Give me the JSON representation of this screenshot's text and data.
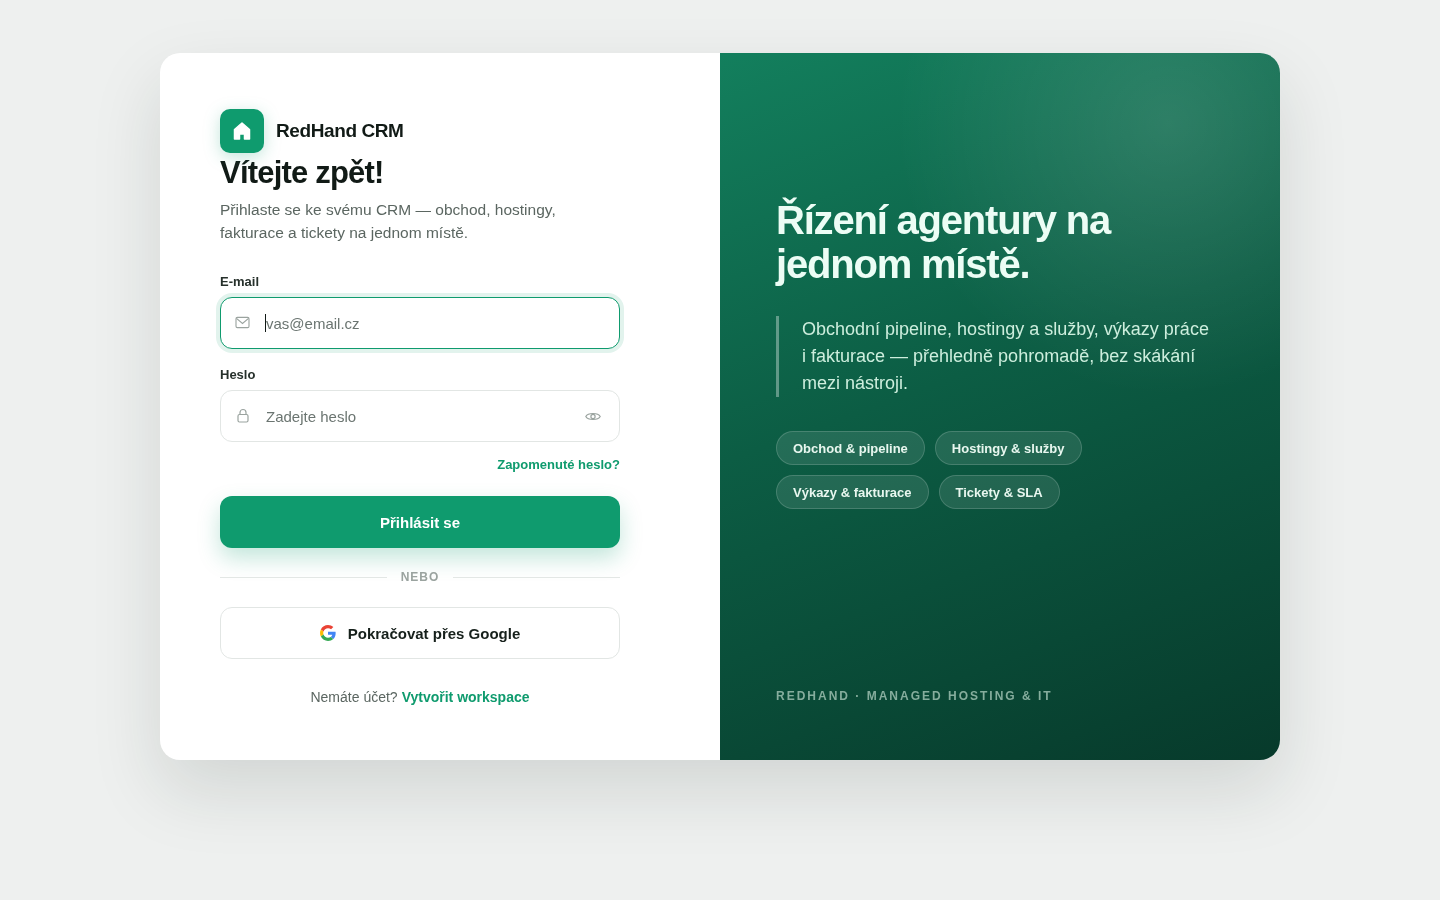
{
  "brand": {
    "name": "RedHand CRM"
  },
  "login": {
    "title": "Vítejte zpět!",
    "subtitle": "Přihlaste se ke svému CRM — obchod, hostingy, fakturace a tickety na jednom místě.",
    "fields": [
      {
        "kind": "email",
        "label": "E-mail",
        "placeholder": "vas@email.cz",
        "focused": true
      },
      {
        "kind": "password",
        "label": "Heslo",
        "placeholder": "Zadejte heslo",
        "focused": false
      }
    ],
    "forgot_link": "Zapomenuté heslo?",
    "submit_button": "Přihlásit se",
    "divider": "NEBO",
    "google_button": "Pokračovat přes Google",
    "signup": {
      "text": "Nemáte účet?",
      "link": "Vytvořit workspace"
    }
  },
  "promo": {
    "title": "Řízení agentury na jednom místě.",
    "text": "Obchodní pipeline, hostingy a služby, výkazy práce i fakturace — přehledně pohromadě, bez skákání mezi nástroji.",
    "chips": [
      "Obchod & pipeline",
      "Hostingy & služby",
      "Výkazy & fakturace",
      "Tickety & SLA"
    ],
    "footer": "REDHAND · MANAGED HOSTING & IT"
  }
}
